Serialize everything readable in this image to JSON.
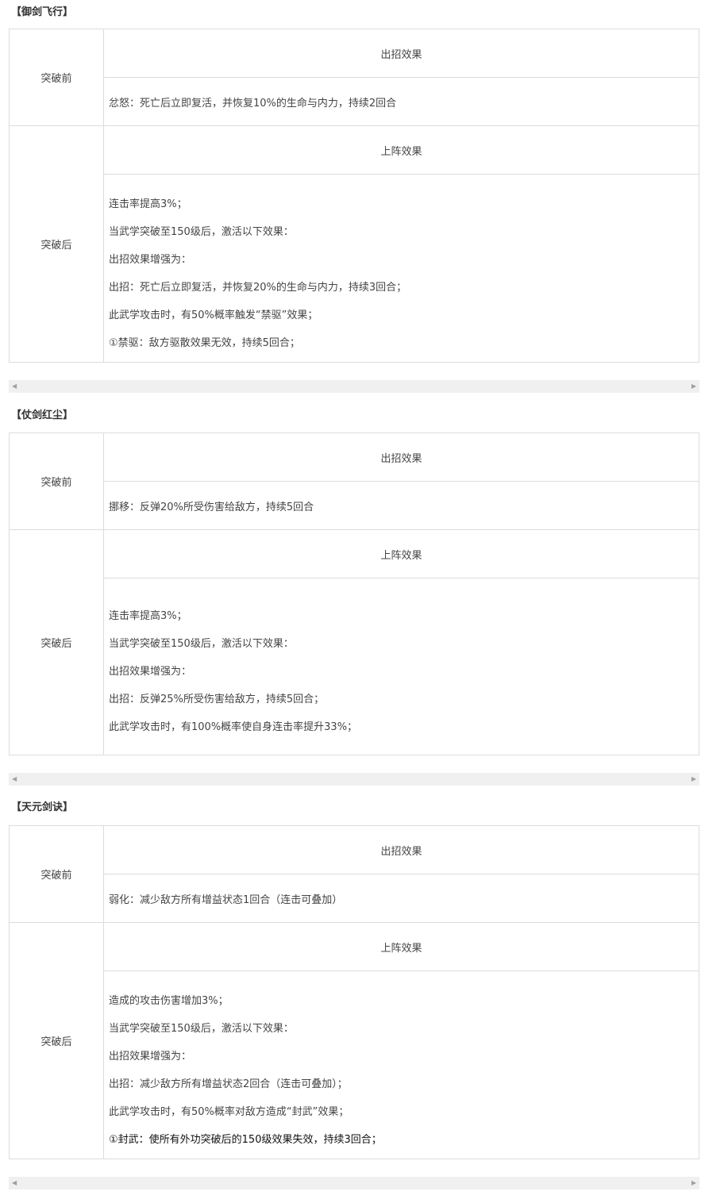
{
  "sections": [
    {
      "title": "【御剑飞行】",
      "before_label": "突破前",
      "before_header": "出招效果",
      "before_desc": "忿怒：死亡后立即复活，并恢复10%的生命与内力，持续2回合",
      "after_label": "突破后",
      "after_header": "上阵效果",
      "after_lines": [
        "连击率提高3%；",
        "当武学突破至150级后，激活以下效果：",
        "出招效果增强为：",
        "出招：死亡后立即复活，并恢复20%的生命与内力，持续3回合；",
        "此武学攻击时，有50%概率触发“禁驱”效果；",
        "①禁驱：敌方驱散效果无效，持续5回合；"
      ]
    },
    {
      "title": "【仗剑红尘】",
      "before_label": "突破前",
      "before_header": "出招效果",
      "before_desc": "挪移：反弹20%所受伤害给敌方，持续5回合",
      "after_label": "突破后",
      "after_header": "上阵效果",
      "after_lines": [
        "连击率提高3%；",
        "当武学突破至150级后，激活以下效果：",
        "出招效果增强为：",
        "出招：反弹25%所受伤害给敌方，持续5回合；",
        "此武学攻击时，有100%概率使自身连击率提升33%；"
      ]
    },
    {
      "title": "【天元剑诀】",
      "before_label": "突破前",
      "before_header": "出招效果",
      "before_desc": "弱化：减少敌方所有增益状态1回合（连击可叠加）",
      "after_label": "突破后",
      "after_header": "上阵效果",
      "after_lines": [
        "造成的攻击伤害增加3%；",
        "当武学突破至150级后，激活以下效果：",
        "出招效果增强为：",
        "出招：减少敌方所有增益状态2回合（连击可叠加）；",
        "此武学攻击时，有50%概率对敌方造成“封武”效果；",
        "①封武：使所有外功突破后的150级效果失效，持续3回合；"
      ]
    }
  ],
  "icons": {
    "scroll_left": "scroll-left-arrow-icon",
    "scroll_right": "scroll-right-arrow-icon"
  }
}
